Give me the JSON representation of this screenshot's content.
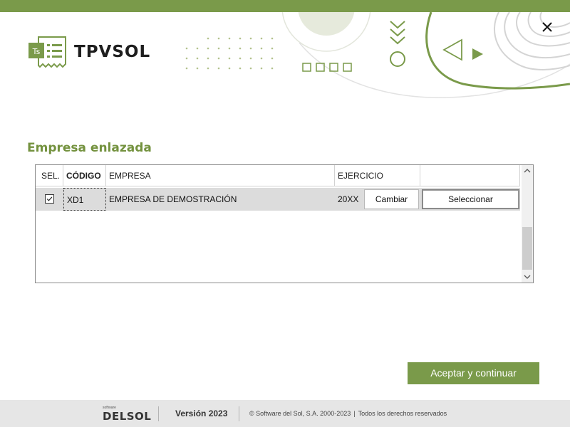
{
  "app": {
    "name": "TPVSOL"
  },
  "section": {
    "title": "Empresa enlazada"
  },
  "grid": {
    "headers": {
      "sel": "SEL.",
      "codigo": "CÓDIGO",
      "empresa": "EMPRESA",
      "ejercicio": "EJERCICIO"
    },
    "rows": [
      {
        "selected": true,
        "codigo": "XD1",
        "empresa": "EMPRESA DE DEMOSTRACIÓN",
        "ejercicio": "20XX",
        "cambiar_label": "Cambiar",
        "seleccionar_label": "Seleccionar"
      }
    ]
  },
  "actions": {
    "accept_label": "Aceptar y continuar"
  },
  "footer": {
    "brand_small": "software",
    "brand": "DELSOL",
    "version": "Versión 2023",
    "copyright": "© Software del Sol, S.A. 2000-2023",
    "rights": "Todos los derechos reservados"
  },
  "colors": {
    "accent": "#7a9a4a",
    "title": "#74923f",
    "footer_bg": "#e6e6e6",
    "row_selected": "#dcdcdc"
  },
  "icons": {
    "close": "close-icon",
    "logo": "receipt-logo-icon",
    "checkbox": "checkbox-checked-icon",
    "scroll_up": "chevron-up-icon",
    "scroll_down": "chevron-down-icon"
  }
}
